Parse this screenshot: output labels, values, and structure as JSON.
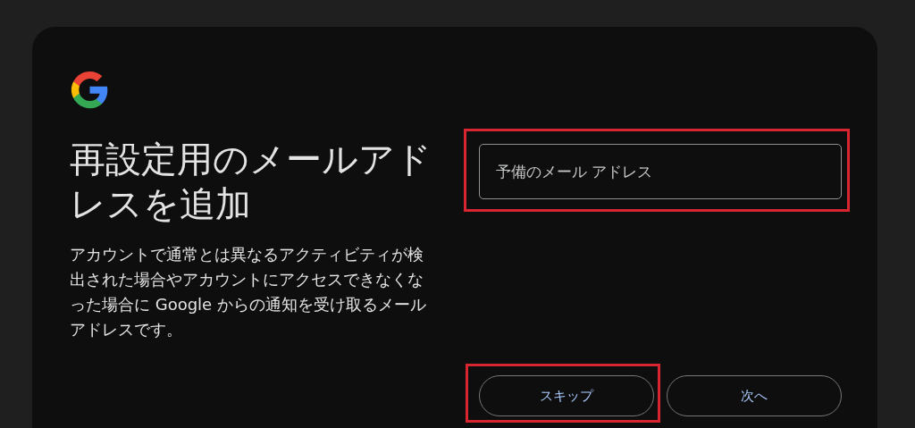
{
  "title": "再設定用のメールアドレスを追加",
  "description": "アカウントで通常とは異なるアクティビティが検出された場合やアカウントにアクセスできなくなった場合に Google からの通知を受け取るメールアドレスです。",
  "email_field": {
    "placeholder": "予備のメール アドレス",
    "highlighted": true
  },
  "buttons": [
    {
      "label": "スキップ",
      "highlighted": true
    },
    {
      "label": "次へ",
      "highlighted": false
    }
  ]
}
